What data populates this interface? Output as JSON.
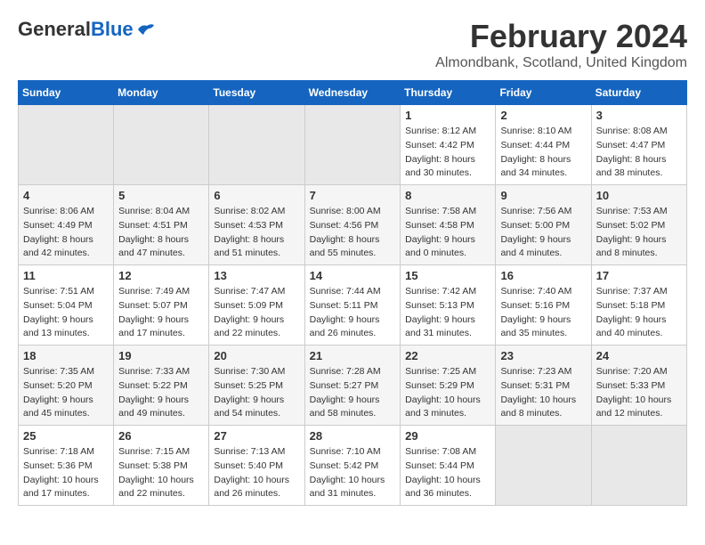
{
  "header": {
    "logo_general": "General",
    "logo_blue": "Blue",
    "month_title": "February 2024",
    "location": "Almondbank, Scotland, United Kingdom"
  },
  "weekdays": [
    "Sunday",
    "Monday",
    "Tuesday",
    "Wednesday",
    "Thursday",
    "Friday",
    "Saturday"
  ],
  "weeks": [
    [
      {
        "day": "",
        "info": ""
      },
      {
        "day": "",
        "info": ""
      },
      {
        "day": "",
        "info": ""
      },
      {
        "day": "",
        "info": ""
      },
      {
        "day": "1",
        "info": "Sunrise: 8:12 AM\nSunset: 4:42 PM\nDaylight: 8 hours\nand 30 minutes."
      },
      {
        "day": "2",
        "info": "Sunrise: 8:10 AM\nSunset: 4:44 PM\nDaylight: 8 hours\nand 34 minutes."
      },
      {
        "day": "3",
        "info": "Sunrise: 8:08 AM\nSunset: 4:47 PM\nDaylight: 8 hours\nand 38 minutes."
      }
    ],
    [
      {
        "day": "4",
        "info": "Sunrise: 8:06 AM\nSunset: 4:49 PM\nDaylight: 8 hours\nand 42 minutes."
      },
      {
        "day": "5",
        "info": "Sunrise: 8:04 AM\nSunset: 4:51 PM\nDaylight: 8 hours\nand 47 minutes."
      },
      {
        "day": "6",
        "info": "Sunrise: 8:02 AM\nSunset: 4:53 PM\nDaylight: 8 hours\nand 51 minutes."
      },
      {
        "day": "7",
        "info": "Sunrise: 8:00 AM\nSunset: 4:56 PM\nDaylight: 8 hours\nand 55 minutes."
      },
      {
        "day": "8",
        "info": "Sunrise: 7:58 AM\nSunset: 4:58 PM\nDaylight: 9 hours\nand 0 minutes."
      },
      {
        "day": "9",
        "info": "Sunrise: 7:56 AM\nSunset: 5:00 PM\nDaylight: 9 hours\nand 4 minutes."
      },
      {
        "day": "10",
        "info": "Sunrise: 7:53 AM\nSunset: 5:02 PM\nDaylight: 9 hours\nand 8 minutes."
      }
    ],
    [
      {
        "day": "11",
        "info": "Sunrise: 7:51 AM\nSunset: 5:04 PM\nDaylight: 9 hours\nand 13 minutes."
      },
      {
        "day": "12",
        "info": "Sunrise: 7:49 AM\nSunset: 5:07 PM\nDaylight: 9 hours\nand 17 minutes."
      },
      {
        "day": "13",
        "info": "Sunrise: 7:47 AM\nSunset: 5:09 PM\nDaylight: 9 hours\nand 22 minutes."
      },
      {
        "day": "14",
        "info": "Sunrise: 7:44 AM\nSunset: 5:11 PM\nDaylight: 9 hours\nand 26 minutes."
      },
      {
        "day": "15",
        "info": "Sunrise: 7:42 AM\nSunset: 5:13 PM\nDaylight: 9 hours\nand 31 minutes."
      },
      {
        "day": "16",
        "info": "Sunrise: 7:40 AM\nSunset: 5:16 PM\nDaylight: 9 hours\nand 35 minutes."
      },
      {
        "day": "17",
        "info": "Sunrise: 7:37 AM\nSunset: 5:18 PM\nDaylight: 9 hours\nand 40 minutes."
      }
    ],
    [
      {
        "day": "18",
        "info": "Sunrise: 7:35 AM\nSunset: 5:20 PM\nDaylight: 9 hours\nand 45 minutes."
      },
      {
        "day": "19",
        "info": "Sunrise: 7:33 AM\nSunset: 5:22 PM\nDaylight: 9 hours\nand 49 minutes."
      },
      {
        "day": "20",
        "info": "Sunrise: 7:30 AM\nSunset: 5:25 PM\nDaylight: 9 hours\nand 54 minutes."
      },
      {
        "day": "21",
        "info": "Sunrise: 7:28 AM\nSunset: 5:27 PM\nDaylight: 9 hours\nand 58 minutes."
      },
      {
        "day": "22",
        "info": "Sunrise: 7:25 AM\nSunset: 5:29 PM\nDaylight: 10 hours\nand 3 minutes."
      },
      {
        "day": "23",
        "info": "Sunrise: 7:23 AM\nSunset: 5:31 PM\nDaylight: 10 hours\nand 8 minutes."
      },
      {
        "day": "24",
        "info": "Sunrise: 7:20 AM\nSunset: 5:33 PM\nDaylight: 10 hours\nand 12 minutes."
      }
    ],
    [
      {
        "day": "25",
        "info": "Sunrise: 7:18 AM\nSunset: 5:36 PM\nDaylight: 10 hours\nand 17 minutes."
      },
      {
        "day": "26",
        "info": "Sunrise: 7:15 AM\nSunset: 5:38 PM\nDaylight: 10 hours\nand 22 minutes."
      },
      {
        "day": "27",
        "info": "Sunrise: 7:13 AM\nSunset: 5:40 PM\nDaylight: 10 hours\nand 26 minutes."
      },
      {
        "day": "28",
        "info": "Sunrise: 7:10 AM\nSunset: 5:42 PM\nDaylight: 10 hours\nand 31 minutes."
      },
      {
        "day": "29",
        "info": "Sunrise: 7:08 AM\nSunset: 5:44 PM\nDaylight: 10 hours\nand 36 minutes."
      },
      {
        "day": "",
        "info": ""
      },
      {
        "day": "",
        "info": ""
      }
    ]
  ]
}
